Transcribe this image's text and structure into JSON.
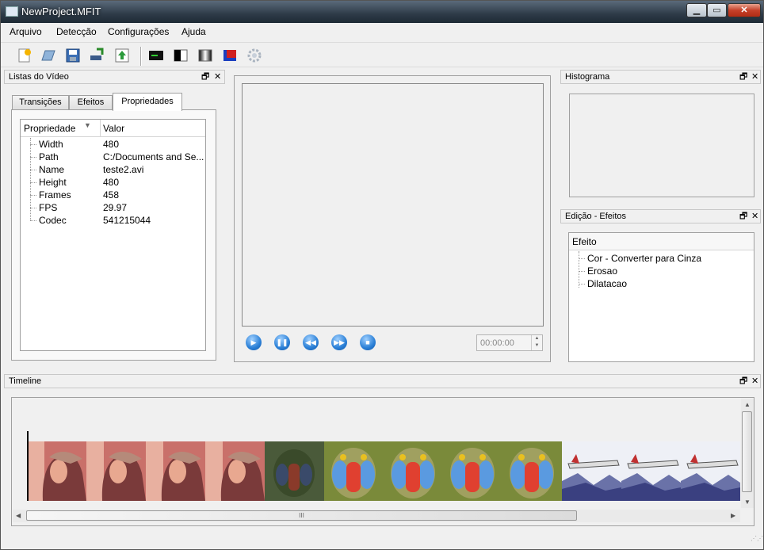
{
  "window": {
    "title": "NewProject.MFIT",
    "min_label": "▁",
    "max_label": "▭",
    "close_label": "✕"
  },
  "menu": [
    "Arquivo",
    "Detecção",
    "Configurações",
    "Ajuda"
  ],
  "toolbar": {
    "icons": [
      "new-project-icon",
      "open-icon",
      "save-icon",
      "import-icon",
      "export-icon",
      "terminal-icon",
      "threshold-icon",
      "gradient-icon",
      "color-icon",
      "settings-gear-icon"
    ]
  },
  "left_dock": {
    "title": "Listas do Vídeo",
    "tabs": [
      "Transições",
      "Efeitos",
      "Propriedades"
    ],
    "active_tab": "Propriedades",
    "columns": [
      "Propriedade",
      "Valor"
    ],
    "rows": [
      {
        "prop": "Width",
        "value": "480"
      },
      {
        "prop": "Path",
        "value": "C:/Documents and Se..."
      },
      {
        "prop": "Name",
        "value": "teste2.avi"
      },
      {
        "prop": "Height",
        "value": "480"
      },
      {
        "prop": "Frames",
        "value": "458"
      },
      {
        "prop": "FPS",
        "value": "29.97"
      },
      {
        "prop": "Codec",
        "value": "541215044"
      }
    ]
  },
  "player": {
    "time": "00:00:00",
    "buttons": [
      "play",
      "pause",
      "rewind",
      "fast-forward",
      "stop"
    ]
  },
  "histogram_dock": {
    "title": "Histograma"
  },
  "effects_dock": {
    "title": "Edição - Efeitos",
    "column": "Efeito",
    "items": [
      "Cor - Converter para Cinza",
      "Erosao",
      "Dilatacao"
    ]
  },
  "timeline_dock": {
    "title": "Timeline",
    "scroll_grip": "III"
  },
  "dock_controls": {
    "float": "🗗",
    "close": "✕"
  },
  "timeline_frames": [
    "lena",
    "lena",
    "lena",
    "lena",
    "mandrill-dark",
    "mandrill",
    "mandrill",
    "mandrill",
    "mandrill",
    "jet",
    "jet",
    "jet"
  ]
}
